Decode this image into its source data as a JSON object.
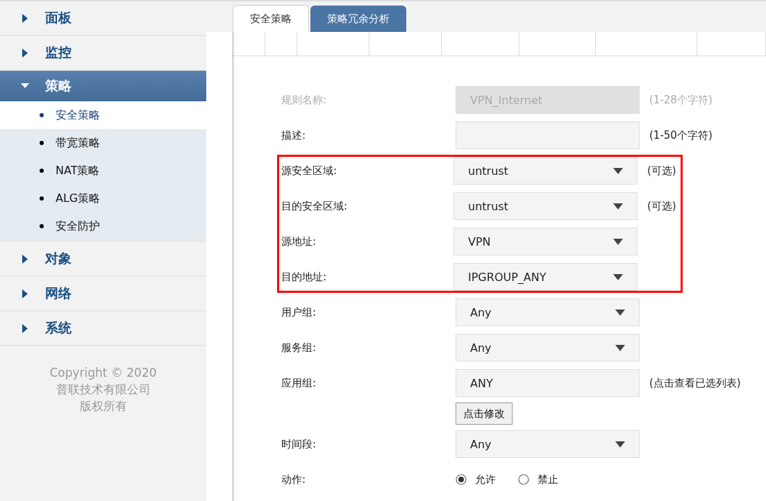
{
  "sidebar": {
    "menu": [
      {
        "label": "面板",
        "expanded": false,
        "selected": false
      },
      {
        "label": "监控",
        "expanded": false,
        "selected": false
      },
      {
        "label": "策略",
        "expanded": true,
        "selected": true,
        "children": [
          {
            "label": "安全策略",
            "selected": true
          },
          {
            "label": "带宽策略",
            "selected": false
          },
          {
            "label": "NAT策略",
            "selected": false
          },
          {
            "label": "ALG策略",
            "selected": false
          },
          {
            "label": "安全防护",
            "selected": false
          }
        ]
      },
      {
        "label": "对象",
        "expanded": false,
        "selected": false
      },
      {
        "label": "网络",
        "expanded": false,
        "selected": false
      },
      {
        "label": "系统",
        "expanded": false,
        "selected": false
      }
    ],
    "copyright": [
      "Copyright © 2020",
      "普联技术有限公司",
      "版权所有"
    ]
  },
  "tabs": [
    {
      "label": "安全策略",
      "selected": true
    },
    {
      "label": "策略冗余分析",
      "selected": false
    }
  ],
  "form": {
    "fields": [
      {
        "kind": "text",
        "label": "规则名称:",
        "value": "VPN_Internet",
        "hint": "(1-28个字符)",
        "disabled": true,
        "highlighted": false
      },
      {
        "kind": "text",
        "label": "描述:",
        "hint": "(1-50个字符)",
        "disabled": false,
        "highlighted": false
      },
      {
        "kind": "select",
        "label": "源安全区域:",
        "value": "untrust",
        "hint": "(可选)",
        "disabled": false,
        "highlighted": true
      },
      {
        "kind": "select",
        "label": "目的安全区域:",
        "value": "untrust",
        "hint": "(可选)",
        "disabled": false,
        "highlighted": true
      },
      {
        "kind": "select",
        "label": "源地址:",
        "value": "VPN",
        "disabled": false,
        "highlighted": true
      },
      {
        "kind": "select",
        "label": "目的地址:",
        "value": "IPGROUP_ANY",
        "disabled": false,
        "highlighted": true
      },
      {
        "kind": "select",
        "label": "用户组:",
        "value": "Any",
        "disabled": false,
        "highlighted": false
      },
      {
        "kind": "select",
        "label": "服务组:",
        "value": "Any",
        "disabled": false,
        "highlighted": false
      },
      {
        "kind": "text",
        "label": "应用组:",
        "value": "ANY",
        "hint": "(点击查看已选列表)",
        "button": "点击修改",
        "disabled": false,
        "highlighted": false
      },
      {
        "kind": "select",
        "label": "时间段:",
        "value": "Any",
        "disabled": false,
        "highlighted": false
      },
      {
        "kind": "radio",
        "label": "动作:",
        "options": [
          {
            "label": "允许",
            "selected": true
          },
          {
            "label": "禁止",
            "selected": false
          }
        ],
        "highlighted": false
      }
    ]
  }
}
